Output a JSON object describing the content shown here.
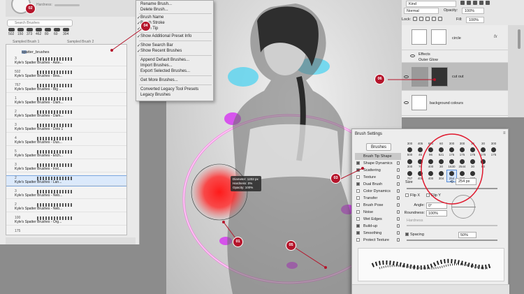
{
  "brushes_panel": {
    "hardness_label": "Hardness:",
    "search_placeholder": "Search Brushes",
    "recent_sizes": [
      "502",
      "150",
      "373",
      "462",
      "80",
      "60",
      "304"
    ],
    "sampled_1": "Sampled Brush 1",
    "sampled_2": "Sampled Brush 2",
    "group_name": "spatter_brushes",
    "items": [
      {
        "num": "3",
        "name": "Kyle's Spatter Brushes - Aste..."
      },
      {
        "num": "502",
        "name": "Kyle's Spatter Brushes - Bea..."
      },
      {
        "num": "767",
        "name": "Kyle's Spatter Brushes - Big ..."
      },
      {
        "num": "1",
        "name": "Kyle's Spatter Brushes - Dam..."
      },
      {
        "num": "2",
        "name": "Kyle's Spatter Brushes - Dam..."
      },
      {
        "num": "3",
        "name": "Kyle's Spatter Brushes - Dots 1"
      },
      {
        "num": "4",
        "name": "Kyle's Spatter Brushes - Dus..."
      },
      {
        "num": "5",
        "name": "Kyle's Spatter Brushes - Etch..."
      },
      {
        "num": "3",
        "name": "Kyle's Spatter Brushes - Inst..."
      },
      {
        "num": "2",
        "name": "Kyle's Spatter Brushes - Lan..."
      },
      {
        "num": "3",
        "name": "Kyle's Spatter Brushes - Neb..."
      },
      {
        "num": "2",
        "name": "Kyle's Spatter Brushes - Neb..."
      },
      {
        "num": "100",
        "name": "Kyle's Spatter Brushes - Org..."
      },
      {
        "num": "175",
        "name": ""
      }
    ]
  },
  "menu": {
    "items": [
      {
        "label": "Rename Brush...",
        "checked": false
      },
      {
        "label": "Delete Brush...",
        "checked": false
      },
      {
        "label": "Brush Name",
        "checked": true
      },
      {
        "label": "Brush Stroke",
        "checked": true
      },
      {
        "label": "Brush Tip",
        "checked": true
      },
      {
        "label": "Show Additional Preset Info",
        "checked": true
      },
      {
        "label": "Show Search Bar",
        "checked": true
      },
      {
        "label": "Show Recent Brushes",
        "checked": true
      },
      {
        "label": "Append Default Brushes...",
        "checked": false
      },
      {
        "label": "Import Brushes...",
        "checked": false
      },
      {
        "label": "Export Selected Brushes...",
        "checked": false
      },
      {
        "label": "Get More Brushes...",
        "checked": false
      },
      {
        "label": "Converted Legacy Tool Presets",
        "checked": false
      },
      {
        "label": "Legacy Brushes",
        "checked": false
      }
    ]
  },
  "layers_panel": {
    "kind_filter": "Kind",
    "blend_mode": "Normal",
    "opacity_label": "Opacity:",
    "opacity_value": "100%",
    "lock_label": "Lock:",
    "fill_label": "Fill:",
    "fill_value": "100%",
    "layers": [
      {
        "name": "circle",
        "fx": "fx"
      },
      {
        "name": "Effects",
        "fx": ""
      },
      {
        "name": "Outer Glow",
        "fx": ""
      },
      {
        "name": "cut out",
        "fx": ""
      },
      {
        "name": "background colours",
        "fx": ""
      }
    ]
  },
  "brush_settings": {
    "title": "Brush Settings",
    "brushes_button": "Brushes",
    "options": [
      {
        "label": "Brush Tip Shape",
        "checked": false,
        "active": true
      },
      {
        "label": "Shape Dynamics",
        "checked": true,
        "active": false
      },
      {
        "label": "Scattering",
        "checked": true,
        "active": false
      },
      {
        "label": "Texture",
        "checked": false,
        "active": false
      },
      {
        "label": "Dual Brush",
        "checked": true,
        "active": false
      },
      {
        "label": "Color Dynamics",
        "checked": false,
        "active": false
      },
      {
        "label": "Transfer",
        "checked": false,
        "active": false
      },
      {
        "label": "Brush Pose",
        "checked": false,
        "active": false
      },
      {
        "label": "Noise",
        "checked": false,
        "active": false
      },
      {
        "label": "Wet Edges",
        "checked": false,
        "active": false
      },
      {
        "label": "Build-up",
        "checked": true,
        "active": false
      },
      {
        "label": "Smoothing",
        "checked": true,
        "active": false
      },
      {
        "label": "Protect Texture",
        "checked": false,
        "active": false
      }
    ],
    "tip_rows": [
      [
        "300",
        "405",
        "600",
        "60",
        "300",
        "300",
        "15",
        "30",
        "300"
      ],
      [
        "500",
        "45",
        "96",
        "521",
        "175",
        "175",
        "175",
        "175",
        "175"
      ],
      [
        "300",
        "70",
        "400",
        "30",
        "1630",
        "2544",
        "30",
        "60",
        ""
      ],
      [
        "767",
        "400",
        "400",
        "304",
        "254",
        "200",
        "100",
        "",
        ""
      ]
    ],
    "size_label": "Size",
    "size_value": "254 px",
    "flip_x": "Flip X",
    "flip_y": "Flip Y",
    "angle_label": "Angle:",
    "angle_value": "0°",
    "roundness_label": "Roundness:",
    "roundness_value": "100%",
    "hardness_label": "Hardness",
    "spacing_label": "Spacing",
    "spacing_value": "50%"
  },
  "hud": {
    "diameter": "Diameter: 1202 px",
    "hardness": "Hardness: 0%",
    "opacity": "Opacity: 100%"
  },
  "callouts": [
    "01",
    "02",
    "03",
    "04",
    "05",
    "06"
  ],
  "colors": {
    "callout_red": "#b5152b",
    "brush_red": "#ff1a1a",
    "splatter_cyan": "#4fd3f0",
    "splatter_magenta": "#d63cf0",
    "ring_pink": "#ff6ee8"
  }
}
